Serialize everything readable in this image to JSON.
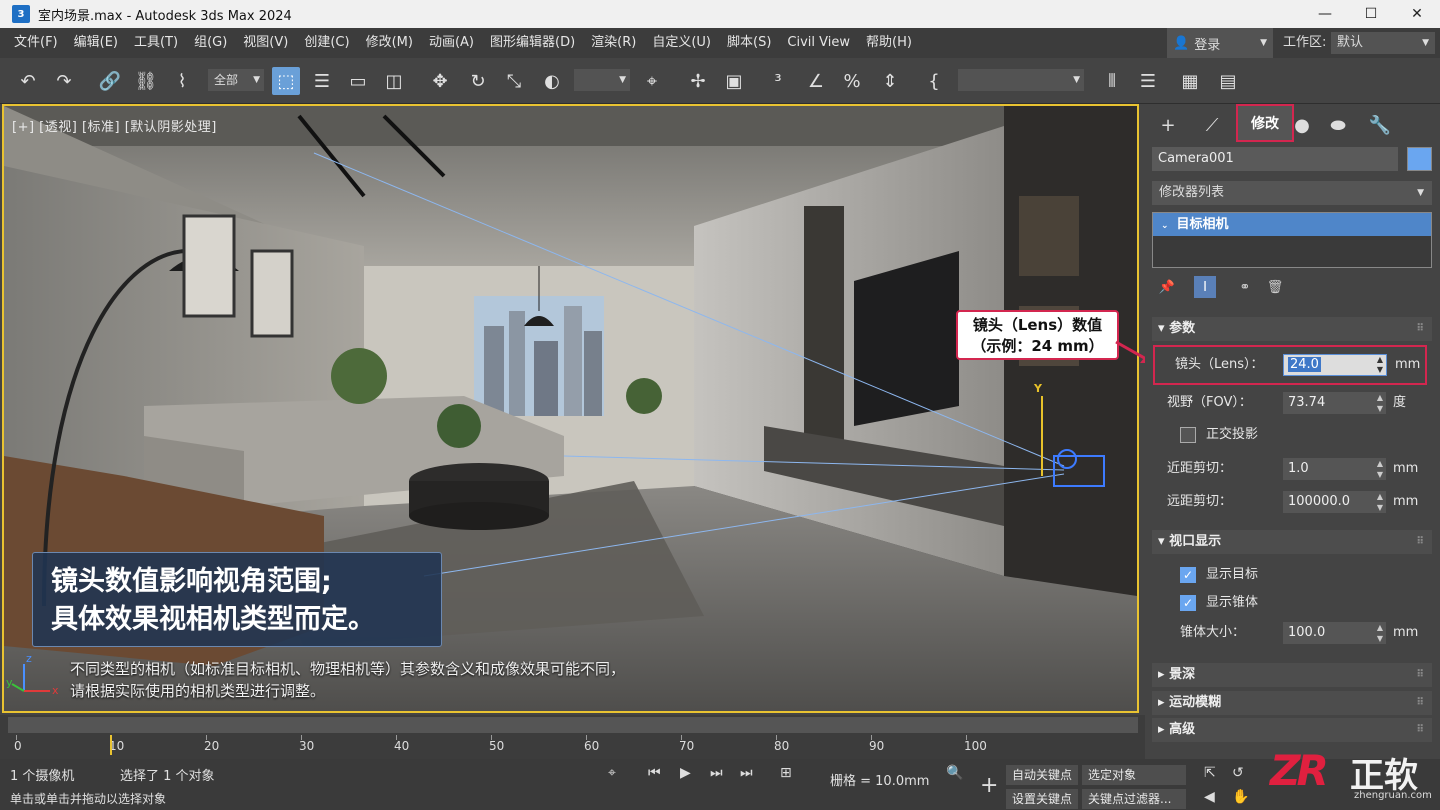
{
  "window": {
    "title": "室内场景.max - Autodesk 3ds Max 2024",
    "app_icon": "3",
    "controls": {
      "minimize": "—",
      "maximize": "☐",
      "close": "✕"
    }
  },
  "menu": {
    "items": [
      "文件(F)",
      "编辑(E)",
      "工具(T)",
      "组(G)",
      "视图(V)",
      "创建(C)",
      "修改(M)",
      "动画(A)",
      "图形编辑器(D)",
      "渲染(R)",
      "自定义(U)",
      "脚本(S)",
      "Civil View",
      "帮助(H)"
    ],
    "login": "登录",
    "workspace_label": "工作区:",
    "workspace_value": "默认"
  },
  "toolbar": {
    "filter_value": "全部",
    "icons": [
      "undo-icon",
      "redo-icon",
      "link-icon",
      "unlink-icon",
      "bind-icon",
      "select-icon",
      "select-by-name-icon",
      "rect-select-icon",
      "window-crossing-icon",
      "move-icon",
      "rotate-icon",
      "scale-icon",
      "ref-coord-icon",
      "pivot-icon",
      "select-manipulate-icon",
      "snap-icon",
      "angle-snap-icon",
      "percent-snap-icon",
      "spinner-snap-icon",
      "named-selection-icon",
      "mirror-icon",
      "align-icon",
      "scene-explorer-icon",
      "layer-explorer-icon"
    ]
  },
  "viewport": {
    "label": "[+] [透视] [标准] [默认阴影处理]",
    "callout_lines": [
      "镜头数值影响视角范围;",
      "具体效果视相机类型而定。"
    ],
    "caption_lines": [
      "不同类型的相机（如标准目标相机、物理相机等）其参数含义和成像效果可能不同，",
      "请根据实际使用的相机类型进行调整。"
    ],
    "lens_callout_lines": [
      "镜头（Lens）数值",
      "（示例：24 mm）"
    ],
    "axis_labels": {
      "x": "x",
      "y": "y",
      "z": "z"
    },
    "target_label": "Y"
  },
  "timeline": {
    "ticks": [
      0,
      10,
      20,
      30,
      40,
      50,
      60,
      70,
      80,
      90,
      100
    ],
    "range_max": 100,
    "current_frame": 10
  },
  "status": {
    "selection_count": "1 个摄像机",
    "selection_text": "选择了 1 个对象",
    "prompt": "单击或单击并拖动以选择对象",
    "grid": "栅格 = 10.0mm",
    "auto_key": "自动关键点",
    "set_key": "设置关键点",
    "selected_object": "选定对象",
    "key_filter": "关键点过滤器..."
  },
  "panel": {
    "tabs": {
      "create": "+",
      "modify": "修改"
    },
    "object_name": "Camera001",
    "object_color": "#6aa6f0",
    "modifier_list": "修改器列表",
    "stack_item": "目标相机",
    "rollouts": {
      "params": "参数",
      "viewport_display": "视口显示",
      "dof": "景深",
      "motion_blur": "运动模糊",
      "advanced": "高级"
    },
    "lens": {
      "label": "镜头（Lens）：",
      "value": "24.0",
      "unit": "mm"
    },
    "fov": {
      "label": "视野（FOV）：",
      "value": "73.74",
      "unit": "度"
    },
    "ortho": {
      "label": "正交投影",
      "checked": false
    },
    "near_clip": {
      "label": "近距剪切：",
      "value": "1.0",
      "unit": "mm"
    },
    "far_clip": {
      "label": "远距剪切：",
      "value": "100000.0",
      "unit": "mm"
    },
    "show_target": {
      "label": "显示目标",
      "checked": true
    },
    "show_cone": {
      "label": "显示锥体",
      "checked": true
    },
    "cone_size": {
      "label": "锥体大小：",
      "value": "100.0",
      "unit": "mm"
    }
  },
  "watermark": {
    "mark": "ZR",
    "name": "正软",
    "url": "zhengruan.com"
  }
}
